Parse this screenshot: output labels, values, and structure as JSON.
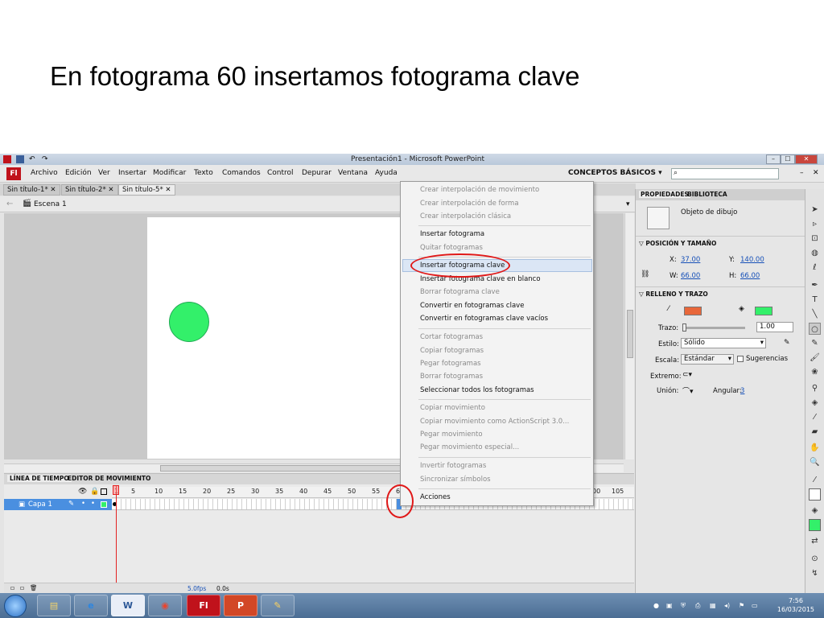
{
  "slide": {
    "title": "En fotograma 60 insertamos fotograma clave"
  },
  "window": {
    "title": "Presentación1 - Microsoft PowerPoint",
    "buttons": [
      "–",
      "☐",
      "✕"
    ]
  },
  "app": {
    "logo": "Fl",
    "menu": [
      "Archivo",
      "Edición",
      "Ver",
      "Insertar",
      "Modificar",
      "Texto",
      "Comandos",
      "Control",
      "Depurar",
      "Ventana",
      "Ayuda"
    ],
    "workspace": "CONCEPTOS BÁSICOS",
    "search_icon": "search-icon"
  },
  "doc_tabs": [
    "Sin título-1*",
    "Sin título-2*",
    "Sin título-5*"
  ],
  "scene": {
    "label": "Escena 1"
  },
  "stage": {
    "circle_color": "#33f06a"
  },
  "timeline": {
    "tabs": [
      "LÍNEA DE TIEMPO",
      "EDITOR DE MOVIMIENTO"
    ],
    "ruler": [
      "1",
      "5",
      "10",
      "15",
      "20",
      "25",
      "30",
      "35",
      "40",
      "45",
      "50",
      "55",
      "6",
      "00",
      "105"
    ],
    "layer": "Capa 1",
    "footer": {
      "fps": "5.0fps",
      "time": "0.0s"
    }
  },
  "context_menu": {
    "items": [
      {
        "label": "Crear interpolación de movimiento",
        "enabled": false
      },
      {
        "label": "Crear interpolación de forma",
        "enabled": false
      },
      {
        "label": "Crear interpolación clásica",
        "enabled": false
      },
      {
        "label": "Insertar fotograma",
        "enabled": true
      },
      {
        "label": "Quitar fotogramas",
        "enabled": false
      },
      {
        "label": "Insertar fotograma clave",
        "enabled": true
      },
      {
        "label": "Insertar fotograma clave en blanco",
        "enabled": true
      },
      {
        "label": "Borrar fotograma clave",
        "enabled": false
      },
      {
        "label": "Convertir en fotogramas clave",
        "enabled": true
      },
      {
        "label": "Convertir en fotogramas clave vacíos",
        "enabled": true
      },
      {
        "label": "Cortar fotogramas",
        "enabled": false
      },
      {
        "label": "Copiar fotogramas",
        "enabled": false
      },
      {
        "label": "Pegar fotogramas",
        "enabled": false
      },
      {
        "label": "Borrar fotogramas",
        "enabled": false
      },
      {
        "label": "Seleccionar todos los fotogramas",
        "enabled": true
      },
      {
        "label": "Copiar movimiento",
        "enabled": false
      },
      {
        "label": "Copiar movimiento como ActionScript 3.0...",
        "enabled": false
      },
      {
        "label": "Pegar movimiento",
        "enabled": false
      },
      {
        "label": "Pegar movimiento especial...",
        "enabled": false
      },
      {
        "label": "Invertir fotogramas",
        "enabled": false
      },
      {
        "label": "Sincronizar símbolos",
        "enabled": false
      },
      {
        "label": "Acciones",
        "enabled": true
      }
    ]
  },
  "properties": {
    "tabs": [
      "PROPIEDADES",
      "BIBLIOTECA"
    ],
    "object": "Objeto de dibujo",
    "sec_pos": "POSICIÓN Y TAMAÑO",
    "x_label": "X:",
    "x_value": "37.00",
    "y_label": "Y:",
    "y_value": "140.00",
    "w_label": "W:",
    "w_value": "66.00",
    "h_label": "H:",
    "h_value": "66.00",
    "sec_fill": "RELLENO Y TRAZO",
    "stroke_color": "#e8673a",
    "fill_color": "#33f06a",
    "trazo_label": "Trazo:",
    "trazo_value": "1.00",
    "estilo_label": "Estilo:",
    "estilo_value": "Sólido",
    "escala_label": "Escala:",
    "escala_value": "Estándar",
    "sugerencias": "Sugerencias",
    "extremo_label": "Extremo:",
    "union_label": "Unión:",
    "angular_label": "Angular:",
    "angular_value": "3"
  },
  "taskbar": {
    "clock_time": "7:56",
    "clock_date": "16/03/2015"
  }
}
